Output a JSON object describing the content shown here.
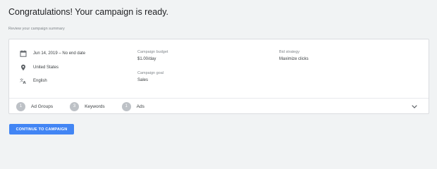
{
  "header": {
    "title": "Congratulations! Your campaign is ready.",
    "subtitle": "Review your campaign summary"
  },
  "summary": {
    "details": [
      {
        "icon": "calendar-icon",
        "text": "Jun 14, 2019 – No end date"
      },
      {
        "icon": "location-pin-icon",
        "text": "United States"
      },
      {
        "icon": "translate-icon",
        "text": "English"
      }
    ],
    "budget_label": "Campaign budget",
    "budget_value": "$1.00/day",
    "goal_label": "Campaign goal",
    "goal_value": "Sales",
    "bid_label": "Bid strategy",
    "bid_value": "Maximize clicks"
  },
  "counts": [
    {
      "count": "1",
      "label": "Ad Groups"
    },
    {
      "count": "3",
      "label": "Keywords"
    },
    {
      "count": "1",
      "label": "Ads"
    }
  ],
  "actions": {
    "continue_label": "CONTINUE TO CAMPAIGN"
  },
  "colors": {
    "accent": "#4285f4",
    "badge": "#bdc1c6",
    "background": "#f1f3f4"
  }
}
